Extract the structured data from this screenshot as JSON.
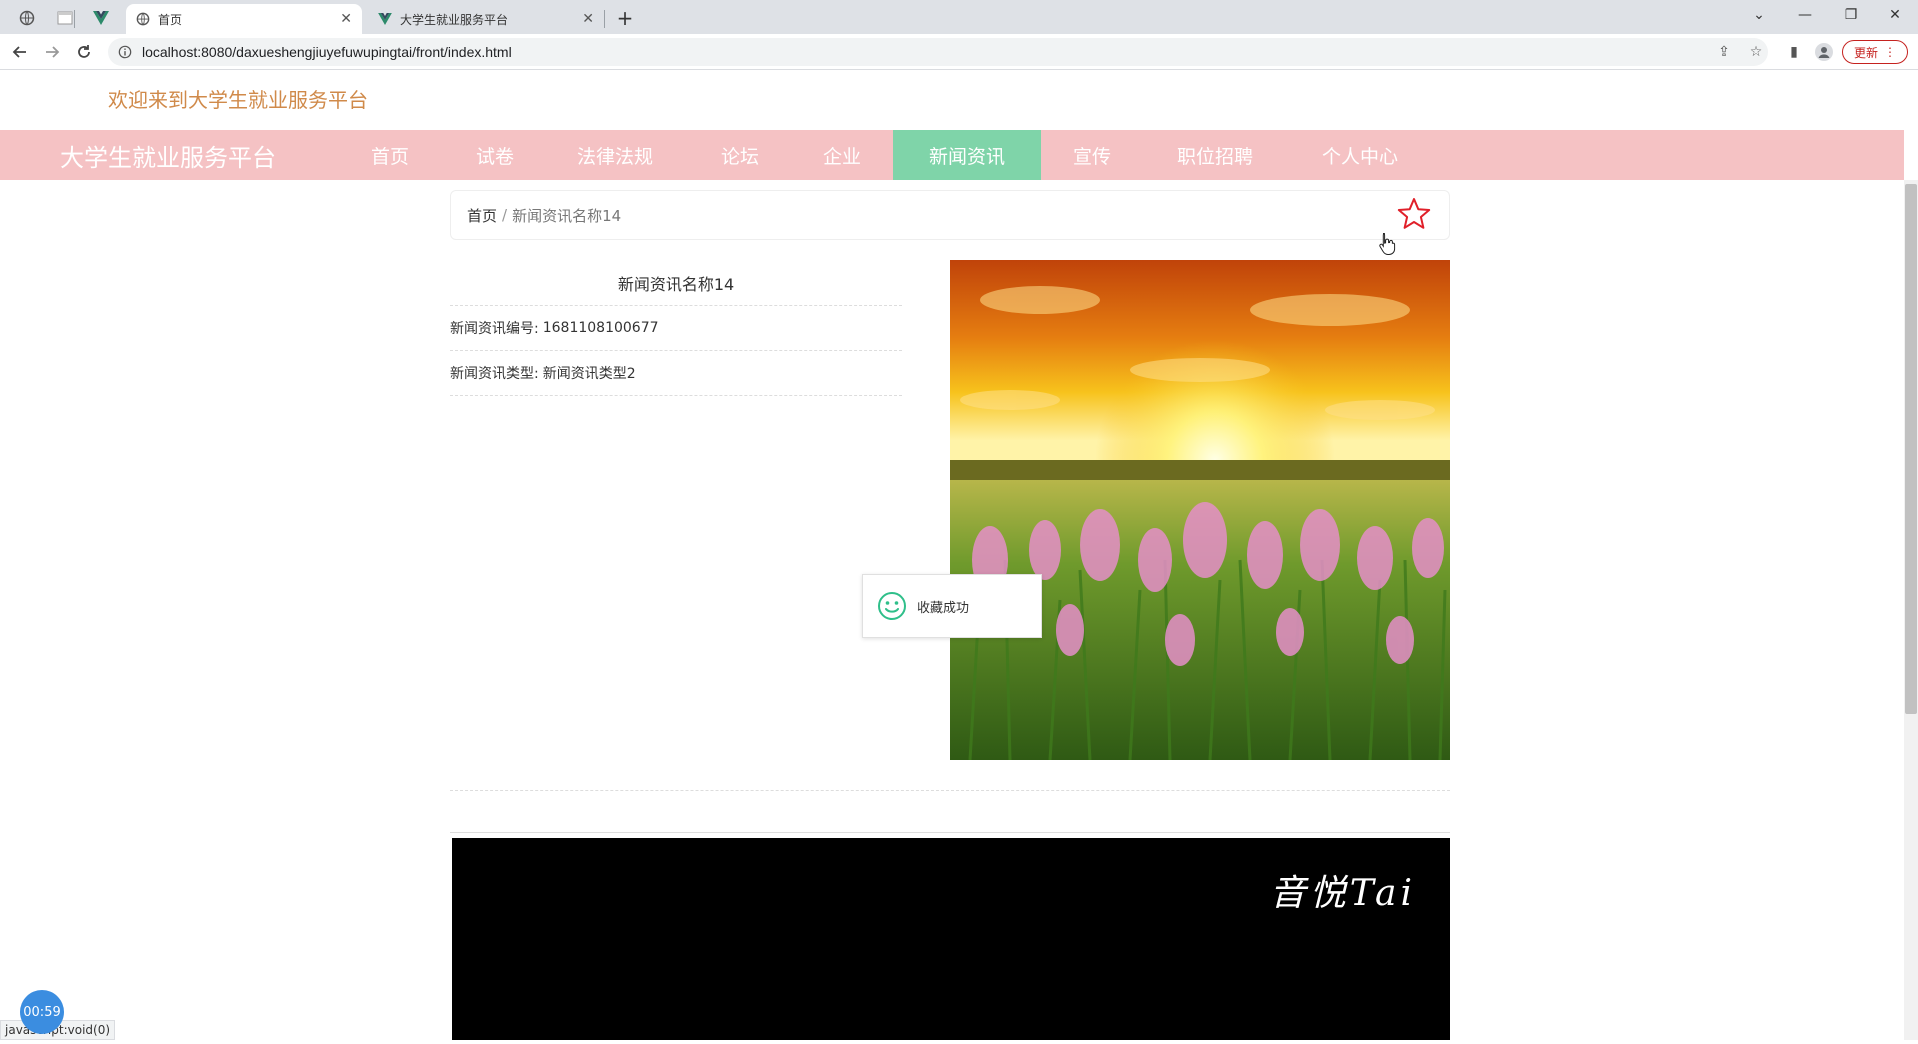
{
  "browser": {
    "tabs": [
      {
        "title": ""
      },
      {
        "title": ""
      },
      {
        "title": ""
      },
      {
        "title": "首页",
        "active": true
      },
      {
        "title": "大学生就业服务平台"
      }
    ],
    "url": "localhost:8080/daxueshengjiuyefuwupingtai/front/index.html",
    "update_label": "更新",
    "status_text": "javascript:void(0)"
  },
  "header": {
    "welcome": "欢迎来到大学生就业服务平台",
    "brand": "大学生就业服务平台",
    "nav": [
      {
        "label": "首页"
      },
      {
        "label": "试卷"
      },
      {
        "label": "法律法规"
      },
      {
        "label": "论坛"
      },
      {
        "label": "企业"
      },
      {
        "label": "新闻资讯",
        "active": true
      },
      {
        "label": "宣传"
      },
      {
        "label": "职位招聘"
      },
      {
        "label": "个人中心"
      }
    ]
  },
  "breadcrumb": {
    "home": "首页",
    "separator": "/",
    "current": "新闻资讯名称14"
  },
  "detail": {
    "title": "新闻资讯名称14",
    "fields": [
      {
        "label": "新闻资讯编号:",
        "value": "1681108100677"
      },
      {
        "label": "新闻资讯类型:",
        "value": "新闻资讯类型2"
      }
    ]
  },
  "toast": {
    "text": "收藏成功"
  },
  "video": {
    "logo_text": "音悦Tai"
  },
  "timer": {
    "text": "00:59"
  },
  "colors": {
    "nav_bg": "#f5c2c4",
    "nav_active": "#7fd4a9",
    "welcome": "#d08a4a",
    "star": "#e0202a"
  }
}
